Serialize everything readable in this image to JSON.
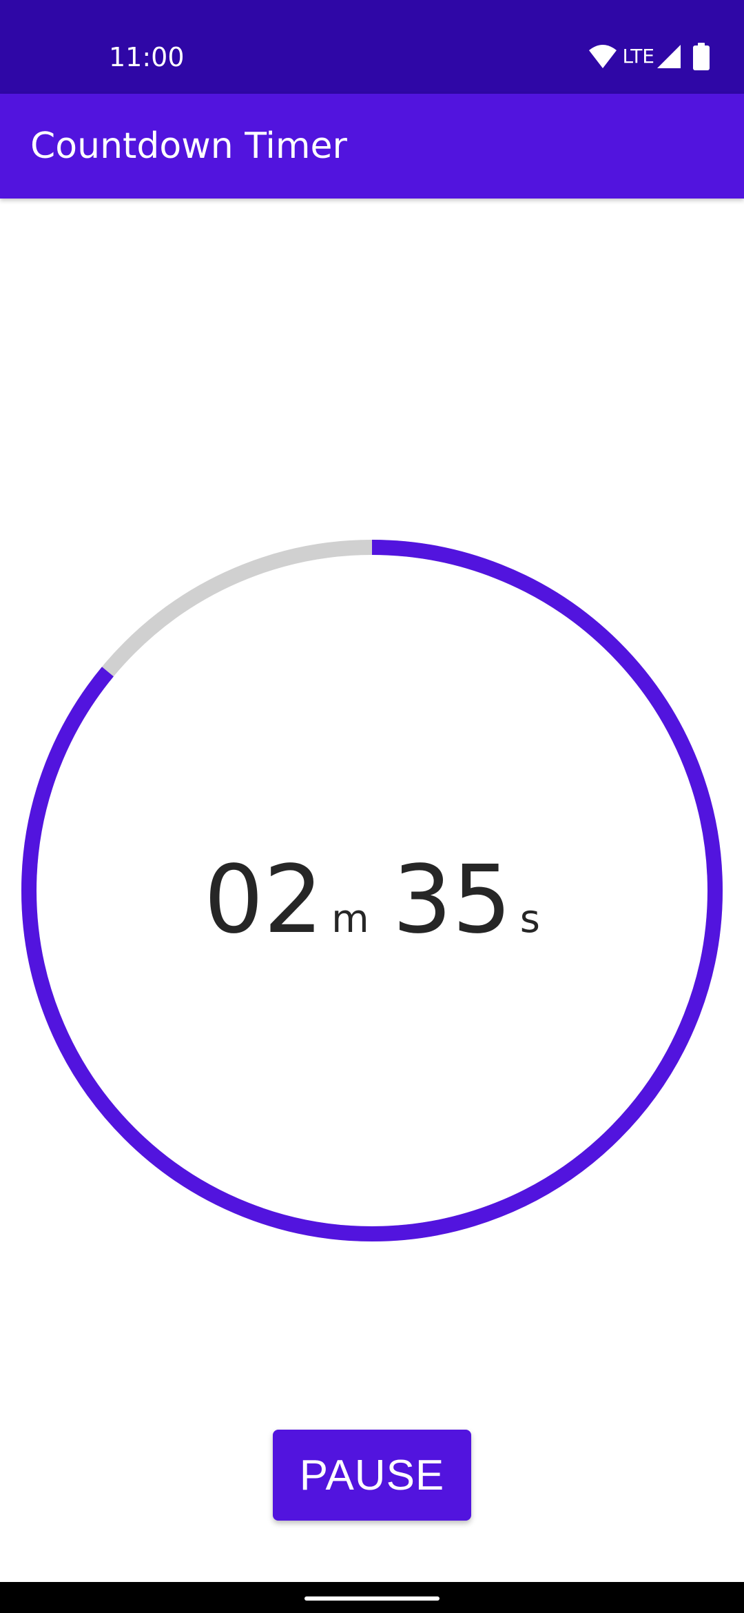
{
  "status_bar": {
    "time": "11:00",
    "network": "LTE",
    "icons": [
      "wifi-icon",
      "signal-icon",
      "battery-icon"
    ]
  },
  "app_bar": {
    "title": "Countdown Timer"
  },
  "timer": {
    "minutes": "02",
    "minutes_unit": "m",
    "seconds": "35",
    "seconds_unit": "s",
    "progress_fraction": 0.86,
    "colors": {
      "progress": "#5214de",
      "track": "#d0d0d0"
    }
  },
  "actions": {
    "pause_label": "PAUSE"
  },
  "colors": {
    "status_bar": "#2f07a6",
    "app_bar": "#5214de",
    "accent": "#5214de"
  }
}
